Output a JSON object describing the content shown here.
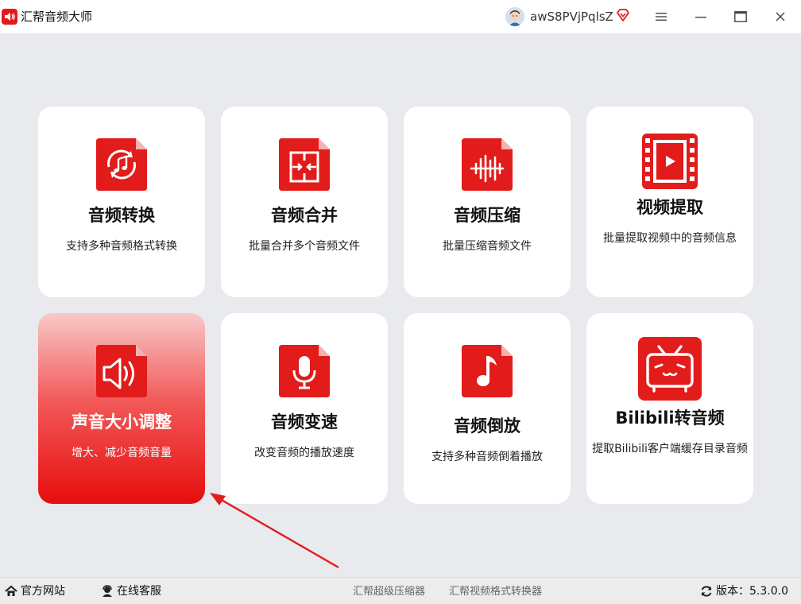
{
  "app": {
    "title": "汇帮音频大师",
    "username": "awS8PVjPqlsZ"
  },
  "colors": {
    "accent": "#e21b1b",
    "background": "#e9eaee",
    "card": "#ffffff"
  },
  "cards": [
    {
      "title": "音频转换",
      "desc": "支持多种音频格式转换",
      "icon": "audio-convert-icon"
    },
    {
      "title": "音频合并",
      "desc": "批量合并多个音频文件",
      "icon": "audio-merge-icon"
    },
    {
      "title": "音频压缩",
      "desc": "批量压缩音频文件",
      "icon": "audio-compress-icon"
    },
    {
      "title": "视频提取",
      "desc": "批量提取视频中的音频信息",
      "icon": "video-extract-icon"
    },
    {
      "title": "声音大小调整",
      "desc": "增大、减少音频音量",
      "icon": "volume-adjust-icon",
      "selected": true
    },
    {
      "title": "音频变速",
      "desc": "改变音频的播放速度",
      "icon": "microphone-icon"
    },
    {
      "title": "音频倒放",
      "desc": "支持多种音频倒着播放",
      "icon": "music-note-icon"
    },
    {
      "title": "Bilibili转音频",
      "desc": "提取Bilibili客户端缓存目录音频",
      "icon": "bilibili-tv-icon"
    }
  ],
  "statusbar": {
    "website": "官方网站",
    "support": "在线客服",
    "link1": "汇帮超级压缩器",
    "link2": "汇帮视频格式转换器",
    "version": "版本：5.3.0.0"
  }
}
